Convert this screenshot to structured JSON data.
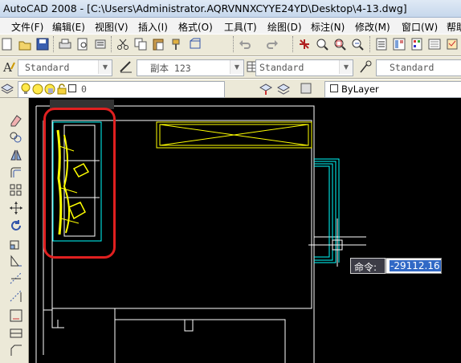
{
  "window": {
    "title": "AutoCAD 2008 - [C:\\Users\\Administrator.AQRVNNXCYYE24YD\\Desktop\\4-13.dwg]"
  },
  "menu": {
    "items": [
      {
        "label": "文件(F)"
      },
      {
        "label": "编辑(E)"
      },
      {
        "label": "视图(V)"
      },
      {
        "label": "插入(I)"
      },
      {
        "label": "格式(O)"
      },
      {
        "label": "工具(T)"
      },
      {
        "label": "绘图(D)"
      },
      {
        "label": "标注(N)"
      },
      {
        "label": "修改(M)"
      },
      {
        "label": "窗口(W)"
      },
      {
        "label": "帮助"
      }
    ]
  },
  "styles_toolbar": {
    "text_style": "Standard",
    "dim_style": "副本 123",
    "table_style": "Standard",
    "multileader_style": "Standard"
  },
  "layers_toolbar": {
    "current_layer": "0",
    "color": "ByLayer"
  },
  "command": {
    "prompt": "命令:",
    "value": "-29112.16"
  },
  "colors": {
    "canvas": "#000000",
    "drawing_lines": "#ffffff",
    "furniture": "#ffff00",
    "cyan_lines": "#00ffff",
    "highlight": "#e02020"
  }
}
